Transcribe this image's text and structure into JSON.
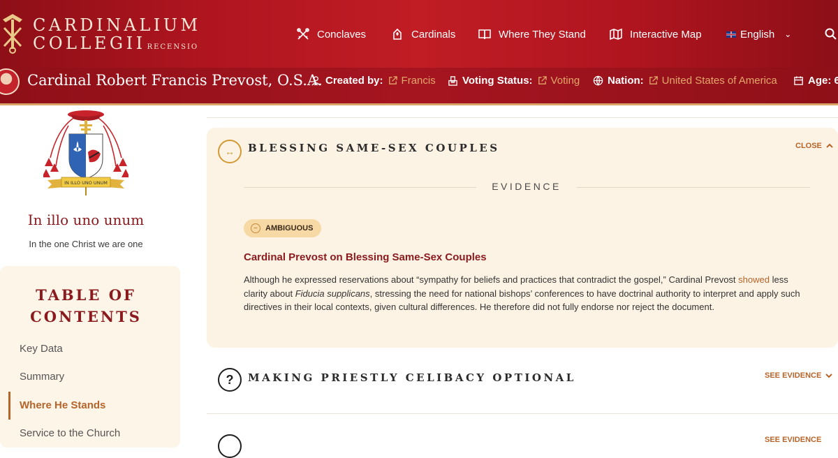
{
  "logo": {
    "line1": "CARDINALIUM",
    "line2": "COLLEGII",
    "line2_small": "RECENSIO"
  },
  "nav": {
    "items": [
      {
        "label": "Conclaves",
        "icon": "crossed-keys-icon"
      },
      {
        "label": "Cardinals",
        "icon": "mitre-icon"
      },
      {
        "label": "Where They Stand",
        "icon": "book-icon"
      },
      {
        "label": "Interactive Map",
        "icon": "map-icon"
      }
    ],
    "language": "English",
    "search_icon": "search-icon"
  },
  "cardinal": {
    "name": "Cardinal Robert Francis Prevost, O.S.A.",
    "created_by_label": "Created by:",
    "created_by": "Francis",
    "voting_status_label": "Voting Status:",
    "voting_status": "Voting",
    "nation_label": "Nation:",
    "nation": "United States of America",
    "age_label": "Age: 6"
  },
  "sidebar": {
    "motto": "In illo uno unum",
    "motto_translation": "In the one Christ we are one",
    "crest_scroll_text": "IN ILLO UNO UNUM",
    "toc_title_line1": "TABLE OF",
    "toc_title_line2": "CONTENTS",
    "toc_items": [
      "Key Data",
      "Summary",
      "Where He Stands",
      "Service to the Church"
    ],
    "toc_active_index": 2
  },
  "main": {
    "topic1": {
      "title": "BLESSING SAME-SEX COUPLES",
      "toggle_label": "CLOSE",
      "evidence_label": "EVIDENCE",
      "badge": "AMBIGUOUS",
      "heading": "Cardinal Prevost on Blessing Same-Sex Couples",
      "body_part1": "Although he expressed reservations about “sympathy for beliefs and practices that contradict the gospel,” Cardinal Prevost ",
      "body_link": "showed",
      "body_part2": " less clarity about ",
      "body_italic": "Fiducia supplicans",
      "body_part3": ", stressing the need for national bishops’ conferences to have doctrinal authority to interpret and apply such directives in their local contexts, given cultural differences. He therefore did not fully endorse nor reject the document."
    },
    "topic2": {
      "title": "MAKING PRIESTLY CELIBACY OPTIONAL",
      "toggle_label": "SEE EVIDENCE"
    },
    "topic3": {
      "toggle_label": "SEE EVIDENCE"
    }
  },
  "colors": {
    "header_red": "#b0151f",
    "accent_gold": "#d29a35",
    "link_orange": "#b5642a",
    "panel_cream": "#fdf3e4",
    "heading_maroon": "#8b1a1e"
  }
}
